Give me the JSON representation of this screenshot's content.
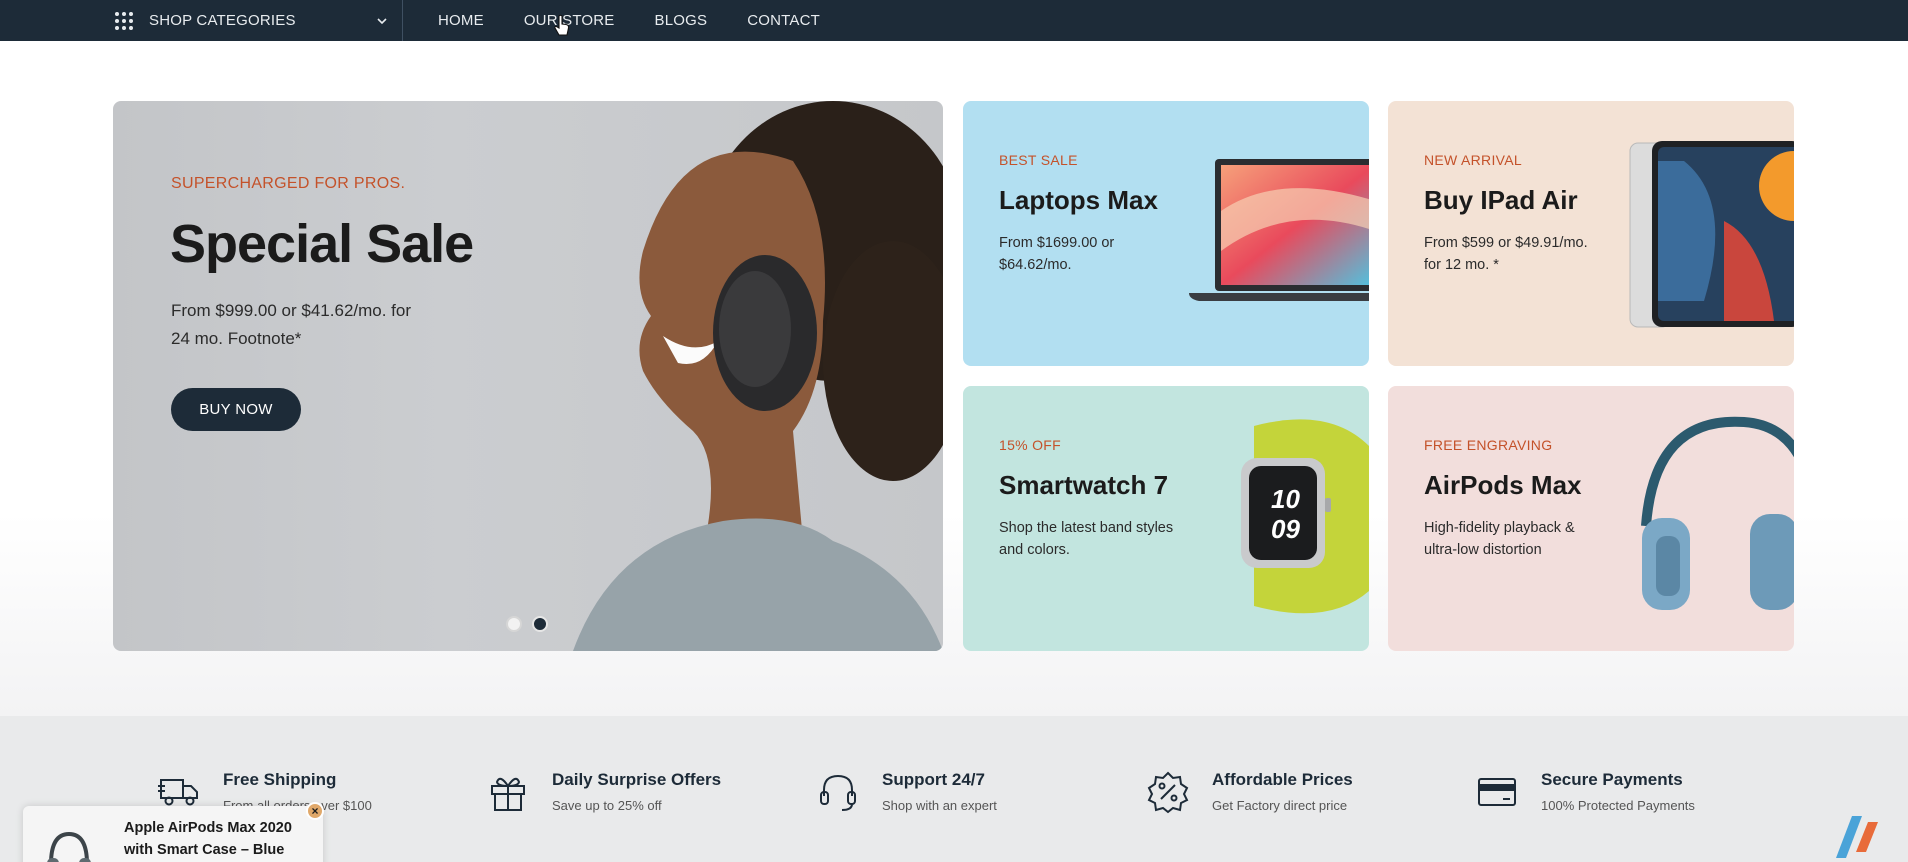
{
  "nav": {
    "categories_label": "SHOP CATEGORIES",
    "links": [
      "HOME",
      "OUR STORE",
      "BLOGS",
      "CONTACT"
    ]
  },
  "hero": {
    "eyebrow": "SUPERCHARGED FOR PROS.",
    "title": "Special Sale",
    "desc": "From $999.00 or $41.62/mo. for 24 mo. Footnote*",
    "button": "BUY NOW"
  },
  "cards": [
    {
      "eyebrow": "BEST SALE",
      "title": "Laptops Max",
      "desc": "From $1699.00 or $64.62/mo."
    },
    {
      "eyebrow": "NEW ARRIVAL",
      "title": "Buy IPad Air",
      "desc": "From $599 or $49.91/mo. for 12 mo. *"
    },
    {
      "eyebrow": "15% OFF",
      "title": "Smartwatch 7",
      "desc": "Shop the latest band styles and colors."
    },
    {
      "eyebrow": "FREE ENGRAVING",
      "title": "AirPods Max",
      "desc": "High-fidelity playback & ultra-low distortion"
    }
  ],
  "features": [
    {
      "icon": "truck-icon",
      "title": "Free Shipping",
      "sub": "From all orders over $100"
    },
    {
      "icon": "gift-icon",
      "title": "Daily Surprise Offers",
      "sub": "Save up to 25% off"
    },
    {
      "icon": "headset-icon",
      "title": "Support 24/7",
      "sub": "Shop with an expert"
    },
    {
      "icon": "percent-badge-icon",
      "title": "Affordable Prices",
      "sub": "Get Factory direct price"
    },
    {
      "icon": "credit-card-icon",
      "title": "Secure Payments",
      "sub": "100% Protected Payments"
    }
  ],
  "popup": {
    "title": "Apple AirPods Max 2020 with Smart Case – Blue",
    "close": "×"
  },
  "colors": {
    "nav_bg": "#1d2b38",
    "accent": "#c4522a",
    "card_laptop": "#b2dff1",
    "card_ipad": "#f3e2d5",
    "card_watch": "#c2e5df",
    "card_airpods": "#f2dedc"
  }
}
